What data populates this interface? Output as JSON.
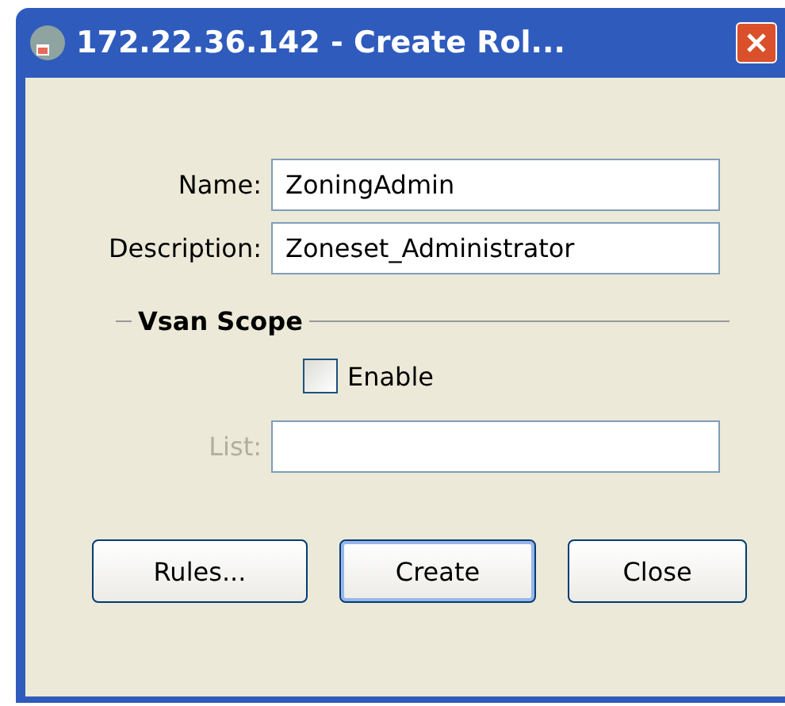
{
  "window": {
    "title": "172.22.36.142 - Create Rol..."
  },
  "fields": [
    {
      "label": "Name:",
      "value": "ZoningAdmin",
      "disabled": false
    },
    {
      "label": "Description:",
      "value": "Zoneset_Administrator",
      "disabled": false
    }
  ],
  "vsan_scope": {
    "title": "Vsan Scope",
    "enable": {
      "label": "Enable",
      "checked": false
    },
    "list": {
      "label": "List:",
      "disabled": true
    }
  },
  "buttons": [
    {
      "label": "Rules...",
      "default": false
    },
    {
      "label": "Create",
      "default": true
    },
    {
      "label": "Close",
      "default": false
    }
  ]
}
